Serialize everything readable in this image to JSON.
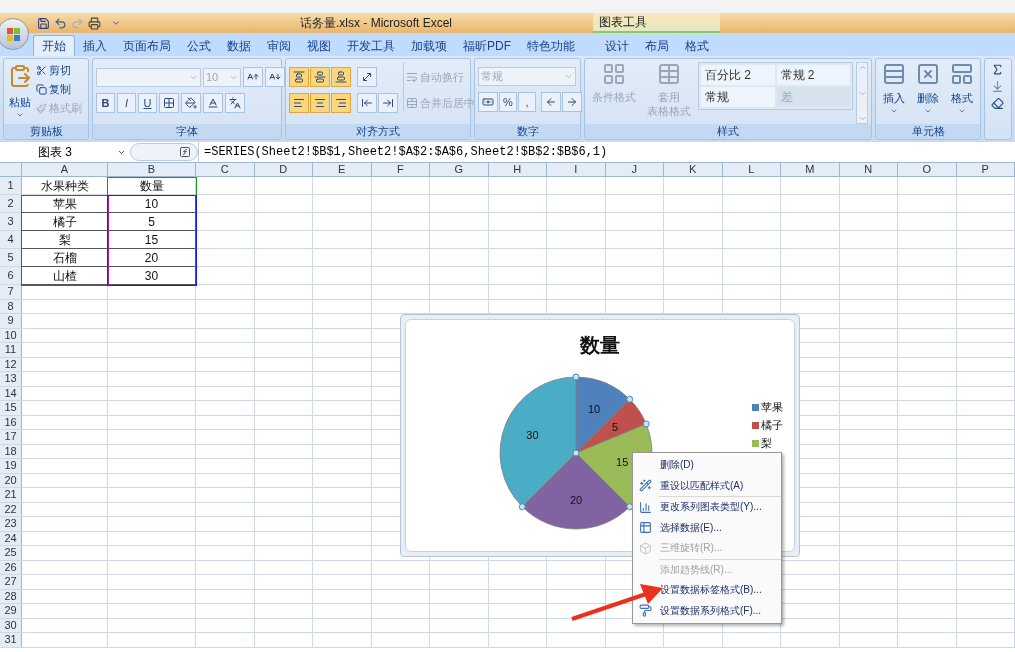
{
  "title_bar": {
    "title": "话务量.xlsx - Microsoft Excel",
    "context_group": "图表工具"
  },
  "tabs": [
    {
      "label": "开始",
      "selected": true
    },
    {
      "label": "插入",
      "selected": false
    },
    {
      "label": "页面布局",
      "selected": false
    },
    {
      "label": "公式",
      "selected": false
    },
    {
      "label": "数据",
      "selected": false
    },
    {
      "label": "审阅",
      "selected": false
    },
    {
      "label": "视图",
      "selected": false
    },
    {
      "label": "开发工具",
      "selected": false
    },
    {
      "label": "加载项",
      "selected": false
    },
    {
      "label": "福昕PDF",
      "selected": false
    },
    {
      "label": "特色功能",
      "selected": false
    }
  ],
  "context_tabs": [
    {
      "label": "设计",
      "selected": false
    },
    {
      "label": "布局",
      "selected": false
    },
    {
      "label": "格式",
      "selected": false
    }
  ],
  "ribbon": {
    "clipboard": {
      "label": "剪贴板",
      "paste": "粘贴",
      "actions": [
        {
          "label": "剪切",
          "disabled": false
        },
        {
          "label": "复制",
          "disabled": false
        },
        {
          "label": "格式刷",
          "disabled": true
        }
      ]
    },
    "font": {
      "label": "字体",
      "size": "10",
      "styles": [
        "B",
        "I",
        "U"
      ]
    },
    "alignment": {
      "label": "对齐方式",
      "top_row": [
        {
          "selected": true
        },
        {
          "selected": true
        },
        {
          "selected": true
        }
      ],
      "bottom_row": [
        {
          "selected": true
        },
        {
          "selected": true
        },
        {
          "selected": true
        }
      ],
      "actions": [
        {
          "label": "自动换行",
          "disabled": true
        },
        {
          "label": "合并后居中",
          "disabled": true
        }
      ]
    },
    "number": {
      "label": "数字",
      "format": "常规",
      "symbols": [
        "%",
        ","
      ]
    },
    "styles": {
      "label": "样式",
      "actions": [
        {
          "lines": [
            "条件格式"
          ],
          "disabled": true
        },
        {
          "lines": [
            "套用",
            "表格格式"
          ],
          "disabled": true
        }
      ],
      "gallery": [
        {
          "label": "百分比 2",
          "disabled": false
        },
        {
          "label": "常规 2",
          "disabled": false
        },
        {
          "label": "常规",
          "disabled": false
        },
        {
          "label": "差",
          "disabled": true
        }
      ]
    },
    "cells": {
      "label": "单元格",
      "actions": [
        "插入",
        "删除",
        "格式"
      ]
    }
  },
  "formula_bar": {
    "name_box": "图表 3",
    "formula": "=SERIES(Sheet2!$B$1,Sheet2!$A$2:$A$6,Sheet2!$B$2:$B$6,1)"
  },
  "sheet": {
    "columns": [
      "A",
      "B",
      "C",
      "D",
      "E",
      "F",
      "G",
      "H",
      "I",
      "J",
      "K",
      "L",
      "M",
      "N",
      "O",
      "P"
    ],
    "rows": [
      {
        "header": "1",
        "cells": [
          "水果种类",
          "数量"
        ]
      },
      {
        "header": "2",
        "cells": [
          "苹果",
          "10"
        ]
      },
      {
        "header": "3",
        "cells": [
          "橘子",
          "5"
        ]
      },
      {
        "header": "4",
        "cells": [
          "梨",
          "15"
        ]
      },
      {
        "header": "5",
        "cells": [
          "石榴",
          "20"
        ]
      },
      {
        "header": "6",
        "cells": [
          "山楂",
          "30"
        ]
      },
      {
        "header": "7"
      },
      {
        "header": "8"
      },
      {
        "header": "9"
      },
      {
        "header": "10"
      },
      {
        "header": "11"
      },
      {
        "header": "12"
      },
      {
        "header": "13"
      },
      {
        "header": "14"
      },
      {
        "header": "15"
      },
      {
        "header": "16"
      },
      {
        "header": "17"
      },
      {
        "header": "18"
      },
      {
        "header": "19"
      },
      {
        "header": "20"
      },
      {
        "header": "21"
      },
      {
        "header": "22"
      },
      {
        "header": "23"
      },
      {
        "header": "24"
      },
      {
        "header": "25"
      },
      {
        "header": "26"
      },
      {
        "header": "27"
      },
      {
        "header": "28"
      },
      {
        "header": "29"
      },
      {
        "header": "30"
      },
      {
        "header": "31"
      }
    ]
  },
  "chart": {
    "chart_data": {
      "type": "pie",
      "title": "数量",
      "series": [
        {
          "values": [
            10,
            5,
            15,
            20,
            30
          ]
        }
      ],
      "data_labels": true
    },
    "legend": [
      "苹果",
      "橘子",
      "梨"
    ]
  },
  "context_menu": {
    "groups": [
      [
        {
          "label": "删除(D)",
          "disabled": false
        },
        {
          "label": "重设以匹配样式(A)",
          "disabled": false
        }
      ],
      [
        {
          "label": "更改系列图表类型(Y)...",
          "disabled": false
        },
        {
          "label": "选择数据(E)...",
          "disabled": false
        },
        {
          "label": "三维旋转(R)...",
          "disabled": true
        }
      ],
      [
        {
          "label": "添加趋势线(R)...",
          "disabled": true
        },
        {
          "label": "设置数据标签格式(B)...",
          "disabled": false
        },
        {
          "label": "设置数据系列格式(F)...",
          "disabled": false
        }
      ]
    ]
  }
}
